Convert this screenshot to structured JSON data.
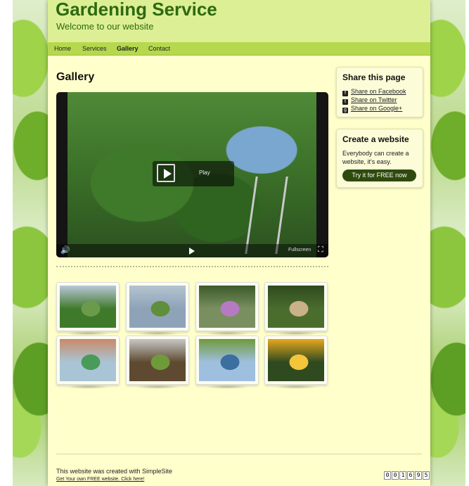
{
  "site": {
    "title": "Gardening Service",
    "slogan": "Welcome to our website"
  },
  "nav": {
    "items": [
      "Home",
      "Services",
      "Gallery",
      "Contact"
    ],
    "active": "Gallery"
  },
  "main": {
    "heading": "Gallery",
    "video": {
      "play_label": "Play",
      "fullscreen_label": "Fullscreen"
    },
    "thumbnails": [
      {
        "icon": "man-trimming-hedge-thumb",
        "colors": [
          "#3f7a2b",
          "#6b9b4a",
          "#b9c7d9"
        ]
      },
      {
        "icon": "truck-in-garden-thumb",
        "colors": [
          "#8ea3b8",
          "#5f8f3a",
          "#b4c4cf"
        ]
      },
      {
        "icon": "purple-flower-thumb",
        "colors": [
          "#7a8f60",
          "#b57ac2",
          "#3c5a2a"
        ]
      },
      {
        "icon": "gloved-hand-pruning-thumb",
        "colors": [
          "#4a6d2d",
          "#c9b18a",
          "#2f4a1f"
        ]
      },
      {
        "icon": "watering-hose-thumb",
        "colors": [
          "#a9c5d5",
          "#4a9a5a",
          "#c98a6a"
        ]
      },
      {
        "icon": "digging-shovel-thumb",
        "colors": [
          "#5e4a30",
          "#6f9a3a",
          "#c7c7c7"
        ]
      },
      {
        "icon": "lawn-mower-thumb",
        "colors": [
          "#9fbfdf",
          "#3a6fa0",
          "#6f9a3a"
        ]
      },
      {
        "icon": "yellow-rose-thumb",
        "colors": [
          "#2f4a1f",
          "#f2c53a",
          "#e6a81f"
        ]
      }
    ]
  },
  "sidebar": {
    "share": {
      "title": "Share this page",
      "links": [
        "Share on Facebook",
        "Share on Twitter",
        "Share on Google+"
      ],
      "icons": [
        "facebook-icon",
        "twitter-icon",
        "google-plus-icon"
      ]
    },
    "create": {
      "title": "Create a website",
      "text": "Everybody can create a website, it's easy.",
      "button": "Try it for FREE now"
    }
  },
  "footer": {
    "text": "This website was created with SimpleSite",
    "link": "Get Your own FREE website. Click here!",
    "counter": "001695"
  }
}
